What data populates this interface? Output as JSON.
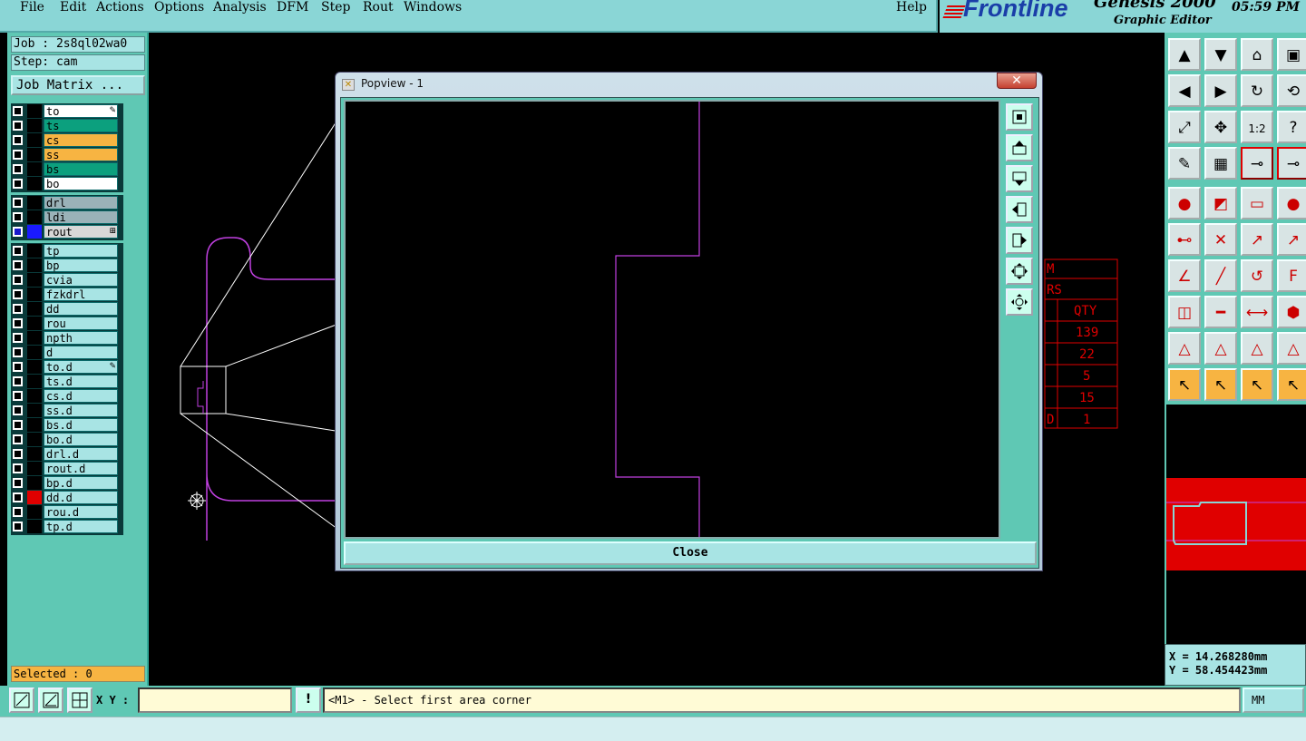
{
  "menu": [
    "File",
    "Edit",
    "Actions",
    "Options",
    "Analysis",
    "DFM",
    "Step",
    "Rout",
    "Windows"
  ],
  "help": "Help",
  "brand": {
    "logo": "Frontline",
    "title": "Genesis 2000",
    "subtitle": "Graphic Editor",
    "clock": "05:59 PM"
  },
  "job": {
    "job_label": "Job : 2s8ql02wa0",
    "step_label": "Step: cam",
    "matrix_button": "Job Matrix ..."
  },
  "layers_board": [
    {
      "name": "to",
      "color": "#ffffff",
      "mark": "✎"
    },
    {
      "name": "ts",
      "color": "#0ca07e"
    },
    {
      "name": "cs",
      "color": "#f7b442"
    },
    {
      "name": "ss",
      "color": "#f7b442"
    },
    {
      "name": "bs",
      "color": "#0ca07e"
    },
    {
      "name": "bo",
      "color": "#ffffff"
    }
  ],
  "layers_drill": [
    {
      "name": "drl",
      "color": "#9ab2b8"
    },
    {
      "name": "ldi",
      "color": "#9ab2b8"
    },
    {
      "name": "rout",
      "color": "#d8d8d8",
      "mark": "⊞",
      "active": true
    }
  ],
  "layers_misc": [
    {
      "name": "tp"
    },
    {
      "name": "bp"
    },
    {
      "name": "cvia"
    },
    {
      "name": "fzkdrl"
    },
    {
      "name": "dd"
    },
    {
      "name": "rou"
    },
    {
      "name": "npth"
    },
    {
      "name": "d"
    },
    {
      "name": "to.d",
      "mark": "✎"
    },
    {
      "name": "ts.d"
    },
    {
      "name": "cs.d"
    },
    {
      "name": "ss.d"
    },
    {
      "name": "bs.d"
    },
    {
      "name": "bo.d"
    },
    {
      "name": "drl.d"
    },
    {
      "name": "rout.d"
    },
    {
      "name": "bp.d"
    },
    {
      "name": "dd.d",
      "swatch": "#e00000"
    },
    {
      "name": "rou.d"
    },
    {
      "name": "tp.d"
    }
  ],
  "selected": "Selected : 0",
  "popview": {
    "title": "Popview - 1",
    "close_x": "✕",
    "close_button": "Close"
  },
  "table_fragment": {
    "rows": [
      "M",
      "RS",
      "QTY",
      "139",
      "22",
      "5",
      "15",
      "1"
    ],
    "left_col_last": "D"
  },
  "coords": {
    "x": "X = 14.268280mm",
    "y": "Y = 58.454423mm"
  },
  "bottom": {
    "xy_label": "X Y :",
    "xy_value": "",
    "message_icon": "!",
    "message": "<M1> - Select first area corner",
    "units": "MM"
  },
  "colors": {
    "panel": "#5fc8b4",
    "light": "#a8e4e4",
    "rout_outline": "#c040e0",
    "table_red": "#e00000"
  },
  "icons": [
    "zoom-home-icon",
    "pan-up-icon",
    "pan-down-icon",
    "pan-left-icon",
    "pan-right-icon",
    "zoom-fit-icon",
    "zoom-center-icon"
  ]
}
